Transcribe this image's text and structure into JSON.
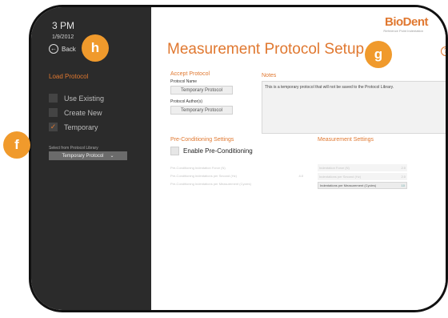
{
  "sidebar": {
    "time": "3 PM",
    "date": "1/9/2012",
    "back_label": "Back",
    "load_protocol_title": "Load Protocol",
    "options": [
      {
        "label": "Use Existing",
        "checked": false
      },
      {
        "label": "Create New",
        "checked": false
      },
      {
        "label": "Temporary",
        "checked": true
      }
    ],
    "library_label": "Select from Protocol Library",
    "library_selected": "Temporary Protocol"
  },
  "header": {
    "brand": "BioDent",
    "brand_sub": "Reference Point Indentation",
    "title": "Measurement Protocol Setup"
  },
  "accept_protocol": {
    "heading": "Accept Protocol",
    "name_label": "Protocol Name",
    "name_value": "Temporary Protocol",
    "author_label": "Protocol Author(s)",
    "author_value": "Temporary Protocol"
  },
  "notes": {
    "heading": "Notes",
    "text": "This is a temporary protocol that will not be saved to the Protocol Library."
  },
  "preconditioning": {
    "heading": "Pre-Conditioning Settings",
    "enable_label": "Enable Pre-Conditioning",
    "rows": [
      {
        "label": "Pre-Conditioning Indentation Force (N)",
        "value": ""
      },
      {
        "label": "Pre-Conditioning Indentations per Second (Hz)",
        "value": "4.0"
      },
      {
        "label": "Pre-Conditioning Indentations per Measurement (Cycles)",
        "value": ""
      }
    ]
  },
  "measurement": {
    "heading": "Measurement Settings",
    "rows": [
      {
        "label": "Indentation Force (N)",
        "value": "2.0"
      },
      {
        "label": "Indentations per Second (Hz)",
        "value": "2.0"
      },
      {
        "label": "Indentations per Measurement (Cycles)",
        "value": "10"
      }
    ]
  },
  "callouts": {
    "f": "f",
    "g": "g",
    "h": "h"
  },
  "colors": {
    "accent": "#e07830",
    "callout": "#f09a2c",
    "sidebar": "#2b2b2b"
  }
}
